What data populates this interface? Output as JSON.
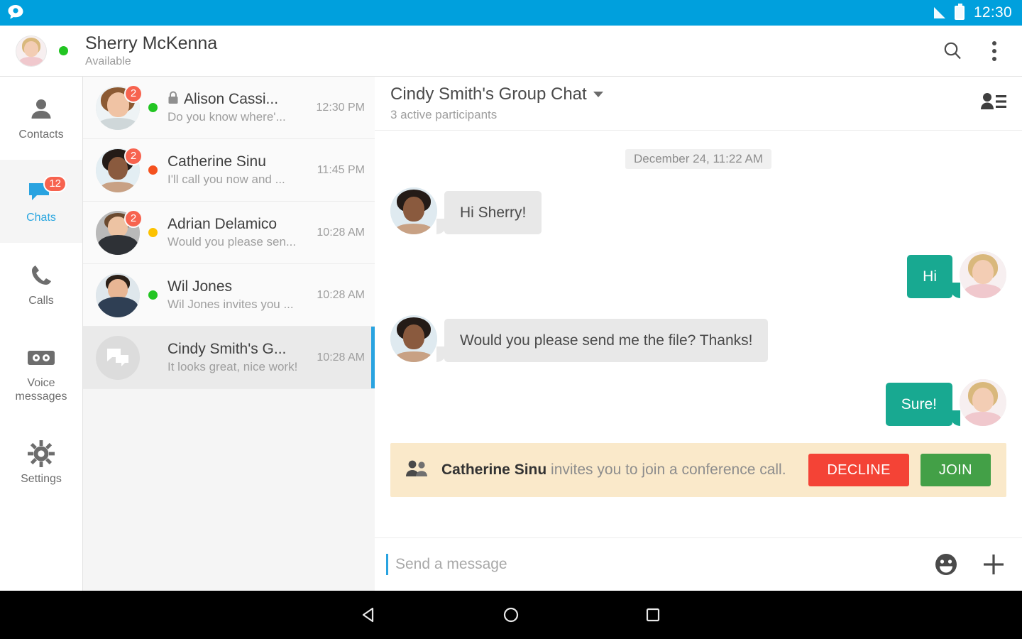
{
  "statusbar": {
    "time": "12:30",
    "signal_icon": "signal-bars-icon",
    "battery_icon": "battery-icon",
    "logo_icon": "app-logo-chat-bubble-icon",
    "background": "#00a0dd"
  },
  "account": {
    "name": "Sherry McKenna",
    "status": "Available",
    "presence_color": "#22c522",
    "avatar_icon": "user-avatar",
    "search_icon": "search-icon",
    "overflow_icon": "overflow-menu-icon"
  },
  "rail": {
    "items": [
      {
        "label": "Contacts",
        "icon": "contacts-person-icon",
        "badge": "",
        "active": false
      },
      {
        "label": "Chats",
        "icon": "chats-bubble-icon",
        "badge": "12",
        "active": true
      },
      {
        "label": "Calls",
        "icon": "calls-phone-icon",
        "badge": "",
        "active": false
      },
      {
        "label": "Voice messages",
        "icon": "voicemail-cassette-icon",
        "badge": "",
        "active": false
      },
      {
        "label": "Settings",
        "icon": "settings-gear-icon",
        "badge": "",
        "active": false
      }
    ]
  },
  "conversations": [
    {
      "name": "Alison Cassi...",
      "preview": "Do you know where'...",
      "time": "12:30 PM",
      "badge": "2",
      "presence": "#22c522",
      "locked": true,
      "selected": false,
      "avatar": "contact-avatar-alison"
    },
    {
      "name": "Catherine Sinu",
      "preview": "I'll call you now and ...",
      "time": "11:45 PM",
      "badge": "2",
      "presence": "#f4511e",
      "locked": false,
      "selected": false,
      "avatar": "contact-avatar-catherine"
    },
    {
      "name": "Adrian Delamico",
      "preview": "Would you please sen...",
      "time": "10:28 AM",
      "badge": "2",
      "presence": "#fcc200",
      "locked": false,
      "selected": false,
      "avatar": "contact-avatar-adrian"
    },
    {
      "name": "Wil Jones",
      "preview": "Wil Jones invites you ...",
      "time": "10:28 AM",
      "badge": "",
      "presence": "#22c522",
      "locked": false,
      "selected": false,
      "avatar": "contact-avatar-wil"
    },
    {
      "name": "Cindy Smith's G...",
      "preview": "It looks great, nice work!",
      "time": "10:28 AM",
      "badge": "",
      "presence": "",
      "locked": false,
      "selected": true,
      "avatar": "group-chat-icon"
    }
  ],
  "chat": {
    "title": "Cindy Smith's Group Chat",
    "subtitle": "3 active participants",
    "participants_icon": "participants-list-icon",
    "date_separator": "December 24, 11:22 AM",
    "messages": [
      {
        "text": "Hi Sherry!",
        "direction": "in",
        "avatar": "contact-avatar-catherine"
      },
      {
        "text": "Hi",
        "direction": "out",
        "avatar": "user-avatar"
      },
      {
        "text": "Would you please send me the file? Thanks!",
        "direction": "in",
        "avatar": "contact-avatar-catherine"
      },
      {
        "text": "Sure!",
        "direction": "out",
        "avatar": "user-avatar"
      }
    ],
    "invite": {
      "icon": "group-people-icon",
      "name": "Catherine Sinu",
      "text": " invites you to join a conference call.",
      "decline_label": "DECLINE",
      "join_label": "JOIN",
      "decline_color": "#f44336",
      "join_color": "#43a047",
      "background": "#fae9ca"
    },
    "composer": {
      "placeholder": "Send a message",
      "value": "",
      "emoji_icon": "emoji-smiley-icon",
      "add_icon": "add-plus-icon"
    }
  },
  "navbar": {
    "back_icon": "android-back-icon",
    "home_icon": "android-home-icon",
    "recents_icon": "android-recents-icon"
  }
}
